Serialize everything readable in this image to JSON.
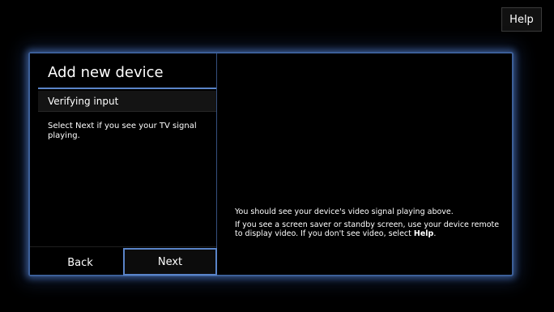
{
  "header": {
    "help_label": "Help"
  },
  "left_panel": {
    "title": "Add new device",
    "subtitle": "Verifying input",
    "instruction": "Select Next if you see your TV signal playing.",
    "back_label": "Back",
    "next_label": "Next"
  },
  "right_panel": {
    "line1": "You should see your device's video signal playing above.",
    "line2_prefix": "If you see a screen saver or standby screen, use your device remote to display video. If you don't see video, select ",
    "line2_bold": "Help",
    "line2_suffix": "."
  },
  "colors": {
    "accent": "#5a84c8",
    "background": "#000000",
    "text": "#ffffff"
  }
}
